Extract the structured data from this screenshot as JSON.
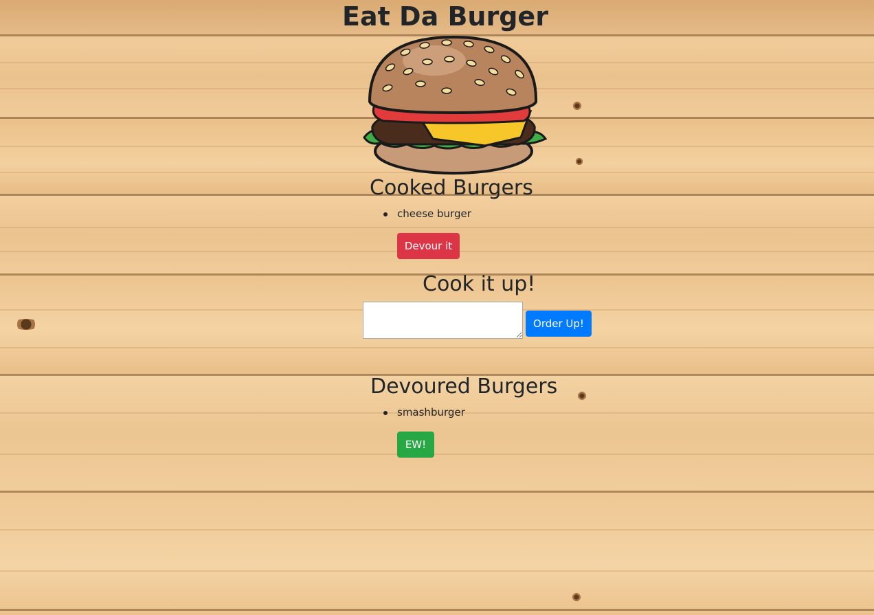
{
  "page": {
    "title": "Eat Da Burger"
  },
  "cooked": {
    "heading": "Cooked Burgers",
    "items": [
      "cheese burger"
    ],
    "action_label": "Devour it"
  },
  "form": {
    "heading": "Cook it up!",
    "input_value": "",
    "submit_label": "Order Up!"
  },
  "devoured": {
    "heading": "Devoured Burgers",
    "items": [
      "smashburger"
    ],
    "action_label": "EW!"
  },
  "colors": {
    "danger": "#dc3545",
    "primary": "#007bff",
    "success": "#28a745",
    "text": "#212529"
  }
}
